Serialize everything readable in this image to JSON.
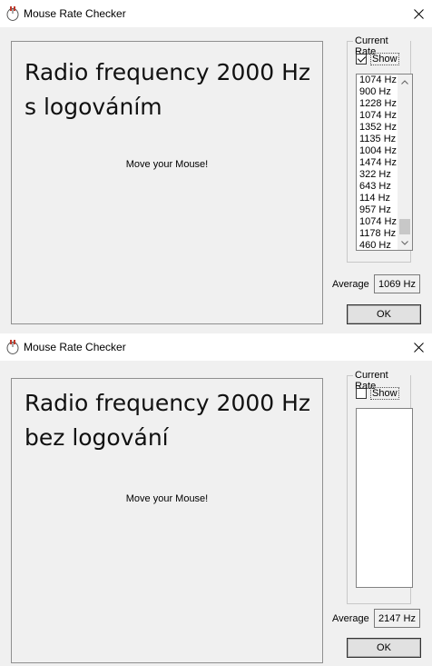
{
  "windows": [
    {
      "title": "Mouse Rate Checker",
      "caption_line1": "Radio frequency 2000 Hz",
      "caption_line2": "s logováním",
      "move_text": "Move your Mouse!",
      "group_title": "Current Rate",
      "show_label": "Show",
      "show_checked": true,
      "rates": [
        "1074 Hz",
        "900 Hz",
        "1228 Hz",
        "1074 Hz",
        "1352 Hz",
        "1135 Hz",
        "1004 Hz",
        "1474 Hz",
        "322 Hz",
        "643 Hz",
        "114 Hz",
        "957 Hz",
        "1074 Hz",
        "1178 Hz",
        "460 Hz"
      ],
      "average_label": "Average",
      "average_value": "1069 Hz",
      "ok_label": "OK"
    },
    {
      "title": "Mouse Rate Checker",
      "caption_line1": "Radio frequency 2000 Hz",
      "caption_line2": "bez logování",
      "move_text": "Move your Mouse!",
      "group_title": "Current Rate",
      "show_label": "Show",
      "show_checked": false,
      "rates": [],
      "average_label": "Average",
      "average_value": "2147 Hz",
      "ok_label": "OK"
    }
  ],
  "icons": {
    "app": "mouse-app-icon",
    "close": "close-icon"
  }
}
